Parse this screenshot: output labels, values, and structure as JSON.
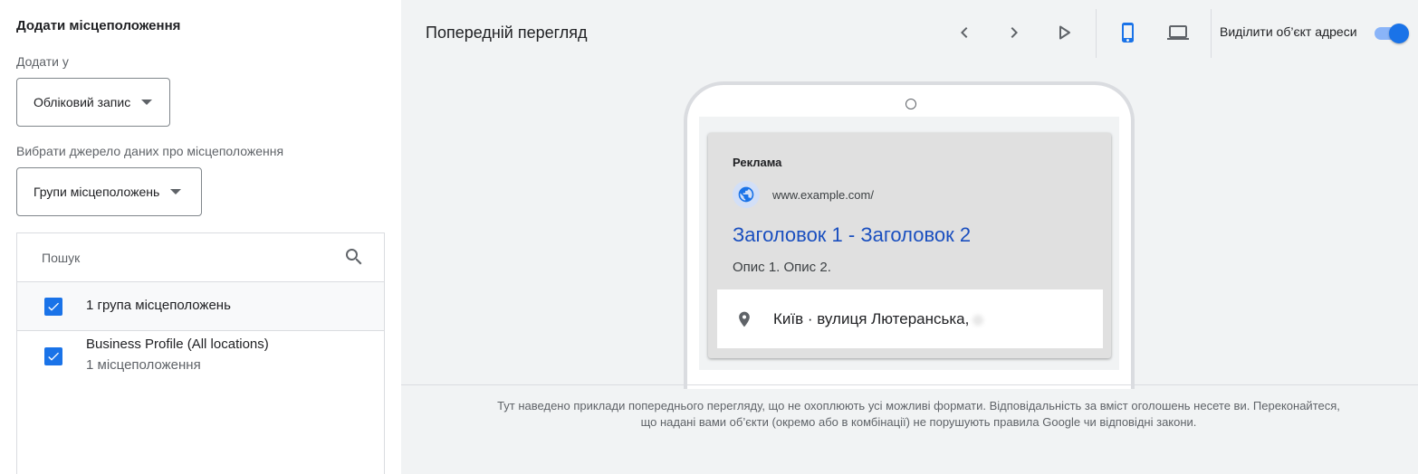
{
  "left": {
    "title": "Додати місцеположення",
    "add_to_label": "Додати у",
    "add_to_value": "Обліковий запис",
    "source_label": "Вибрати джерело даних про місцеположення",
    "source_value": "Групи місцеположень",
    "search_placeholder": "Пошук",
    "items": [
      {
        "title": "1 група місцеположень",
        "checked": true
      },
      {
        "title": "Business Profile (All locations)",
        "subtitle": "1 місцеположення",
        "checked": true
      }
    ]
  },
  "right": {
    "title": "Попередній перегляд",
    "icons": [
      "chevron-left-icon",
      "chevron-right-icon",
      "play-icon",
      "phone-icon",
      "laptop-icon"
    ],
    "toggle_label": "Виділити об’єкт адреси",
    "toggle_on": true,
    "ad": {
      "label": "Реклама",
      "url": "www.example.com/",
      "headline": "Заголовок 1 - Заголовок 2",
      "description": "Опис 1. Опис 2.",
      "address": "Київ · вулиця Лютеранська,"
    },
    "disclaimer_line1": "Тут наведено приклади попереднього перегляду, що не охоплюють усі можливі формати. Відповідальність за вміст оголошень несете ви. Переконайтеся,",
    "disclaimer_line2": "що надані вами об’єкти (окремо або в комбінації) не порушують правила Google чи відповідні закони."
  },
  "colors": {
    "accent": "#1a73e8",
    "headline": "#1a4fbf",
    "panel_bg": "#f1f3f4"
  }
}
